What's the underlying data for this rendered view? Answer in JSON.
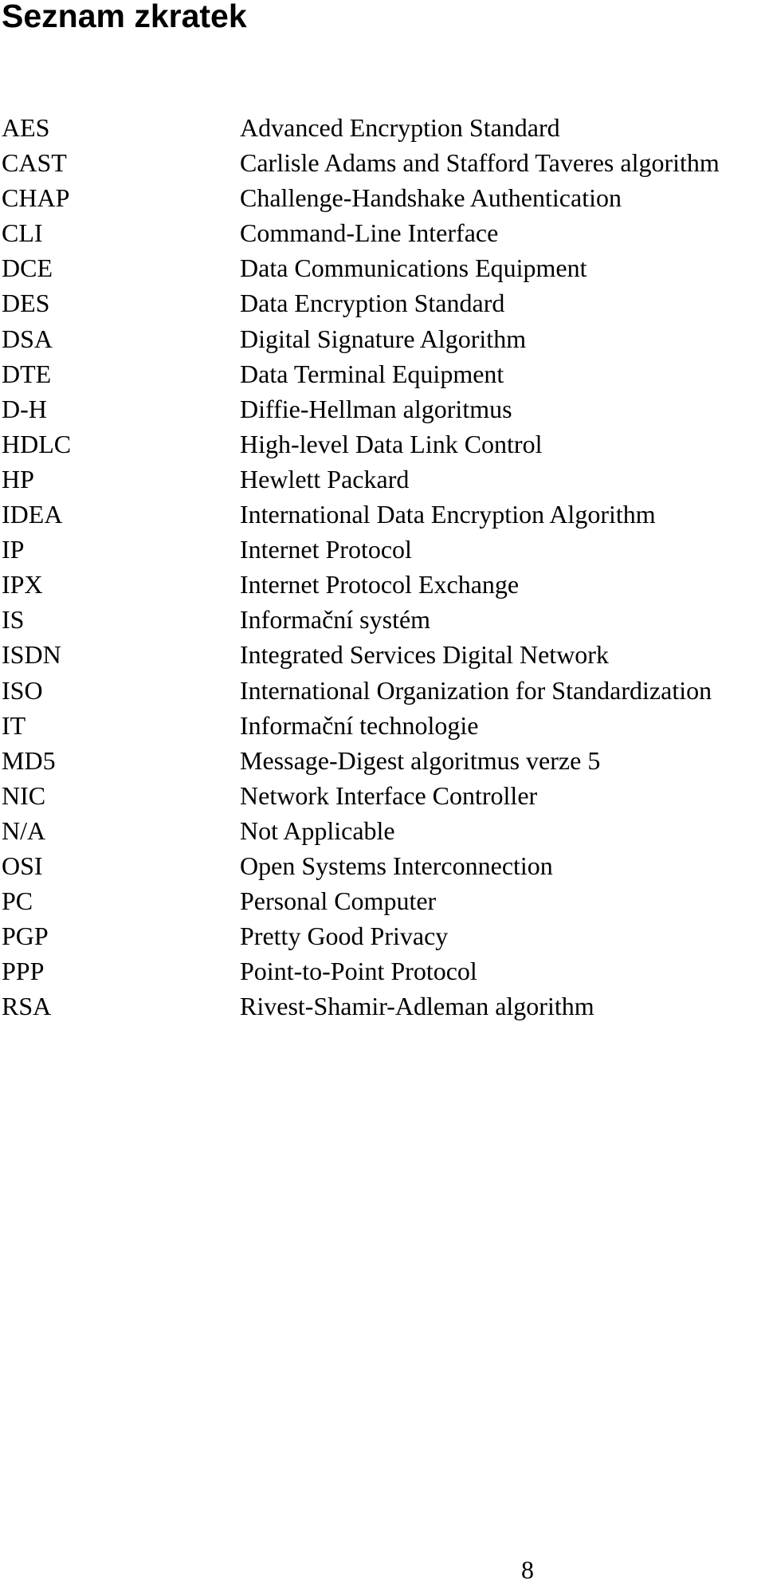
{
  "title": "Seznam zkratek",
  "abbreviations": [
    {
      "term": "AES",
      "definition": "Advanced Encryption Standard"
    },
    {
      "term": "CAST",
      "definition": "Carlisle Adams and Stafford Taveres algorithm"
    },
    {
      "term": "CHAP",
      "definition": "Challenge-Handshake Authentication"
    },
    {
      "term": "CLI",
      "definition": "Command-Line Interface"
    },
    {
      "term": "DCE",
      "definition": "Data Communications Equipment"
    },
    {
      "term": "DES",
      "definition": "Data Encryption Standard"
    },
    {
      "term": "DSA",
      "definition": "Digital Signature Algorithm"
    },
    {
      "term": "DTE",
      "definition": "Data Terminal Equipment"
    },
    {
      "term": "D-H",
      "definition": "Diffie-Hellman algoritmus"
    },
    {
      "term": "HDLC",
      "definition": "High-level Data Link Control"
    },
    {
      "term": "HP",
      "definition": "Hewlett Packard"
    },
    {
      "term": "IDEA",
      "definition": "International Data Encryption Algorithm"
    },
    {
      "term": "IP",
      "definition": "Internet Protocol"
    },
    {
      "term": "IPX",
      "definition": "Internet Protocol Exchange"
    },
    {
      "term": "IS",
      "definition": "Informační systém"
    },
    {
      "term": "ISDN",
      "definition": "Integrated Services Digital Network"
    },
    {
      "term": "ISO",
      "definition": "International Organization for Standardization"
    },
    {
      "term": "IT",
      "definition": "Informační technologie"
    },
    {
      "term": "MD5",
      "definition": "Message-Digest algoritmus verze 5"
    },
    {
      "term": "NIC",
      "definition": "Network Interface Controller"
    },
    {
      "term": "N/A",
      "definition": "Not Applicable"
    },
    {
      "term": "OSI",
      "definition": "Open Systems Interconnection"
    },
    {
      "term": "PC",
      "definition": "Personal Computer"
    },
    {
      "term": "PGP",
      "definition": "Pretty Good Privacy"
    },
    {
      "term": "PPP",
      "definition": "Point-to-Point Protocol"
    },
    {
      "term": "RSA",
      "definition": "Rivest-Shamir-Adleman algorithm"
    }
  ],
  "page_number": "8"
}
